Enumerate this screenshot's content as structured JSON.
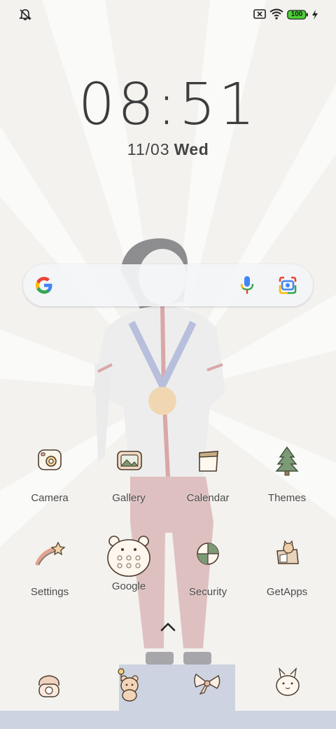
{
  "status_bar": {
    "left_icons": [
      "notifications-off-icon"
    ],
    "right_icons": [
      "no-sim-icon",
      "wifi-icon",
      "battery-icon",
      "charging-bolt-icon"
    ],
    "battery_level": "100",
    "battery_color": "#4cd137"
  },
  "lock_clock": {
    "time": "08:51",
    "date": "11/03",
    "weekday": "Wed"
  },
  "search_bar": {
    "icons": [
      "google-g-icon",
      "microphone-icon",
      "google-lens-icon"
    ]
  },
  "apps": {
    "row1": [
      {
        "label": "Camera",
        "icon": "camera-icon"
      },
      {
        "label": "Gallery",
        "icon": "gallery-icon"
      },
      {
        "label": "Calendar",
        "icon": "calendar-icon"
      },
      {
        "label": "Themes",
        "icon": "tree-icon"
      }
    ],
    "row2": [
      {
        "label": "Settings",
        "icon": "shooting-star-icon"
      },
      {
        "label": "Google",
        "icon": "bear-folder-icon"
      },
      {
        "label": "Security",
        "icon": "shield-icon"
      },
      {
        "label": "GetApps",
        "icon": "cat-box-icon"
      }
    ]
  },
  "dock": {
    "icons": [
      "telephone-icon",
      "bear-messages-icon",
      "bow-browser-icon",
      "bunny-camera-icon"
    ]
  },
  "colors": {
    "background": "#f3f2ef",
    "google_blue": "#4285f4",
    "google_red": "#ea4335",
    "google_yellow": "#fbbc05",
    "google_green": "#34a853"
  }
}
